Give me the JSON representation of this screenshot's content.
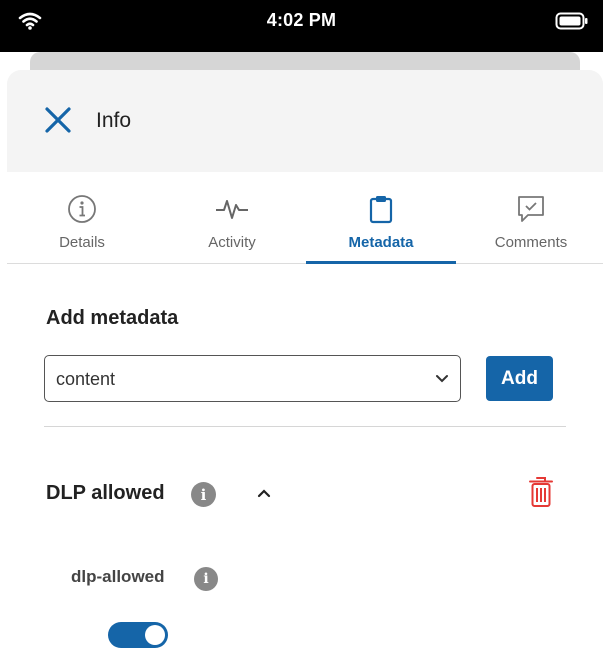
{
  "status_bar": {
    "time": "4:02 PM"
  },
  "header": {
    "title": "Info"
  },
  "tabs": [
    {
      "label": "Details",
      "icon": "info-circle-icon",
      "active": false
    },
    {
      "label": "Activity",
      "icon": "activity-pulse-icon",
      "active": false
    },
    {
      "label": "Metadata",
      "icon": "clipboard-icon",
      "active": true
    },
    {
      "label": "Comments",
      "icon": "comment-check-icon",
      "active": false
    }
  ],
  "add_metadata": {
    "title": "Add metadata",
    "select_value": "content",
    "add_label": "Add"
  },
  "template": {
    "title": "DLP allowed",
    "field": {
      "label": "dlp-allowed",
      "value": true
    }
  },
  "colors": {
    "accent": "#1565a8",
    "delete": "#e53935",
    "header_bg": "#f4f4f4"
  }
}
